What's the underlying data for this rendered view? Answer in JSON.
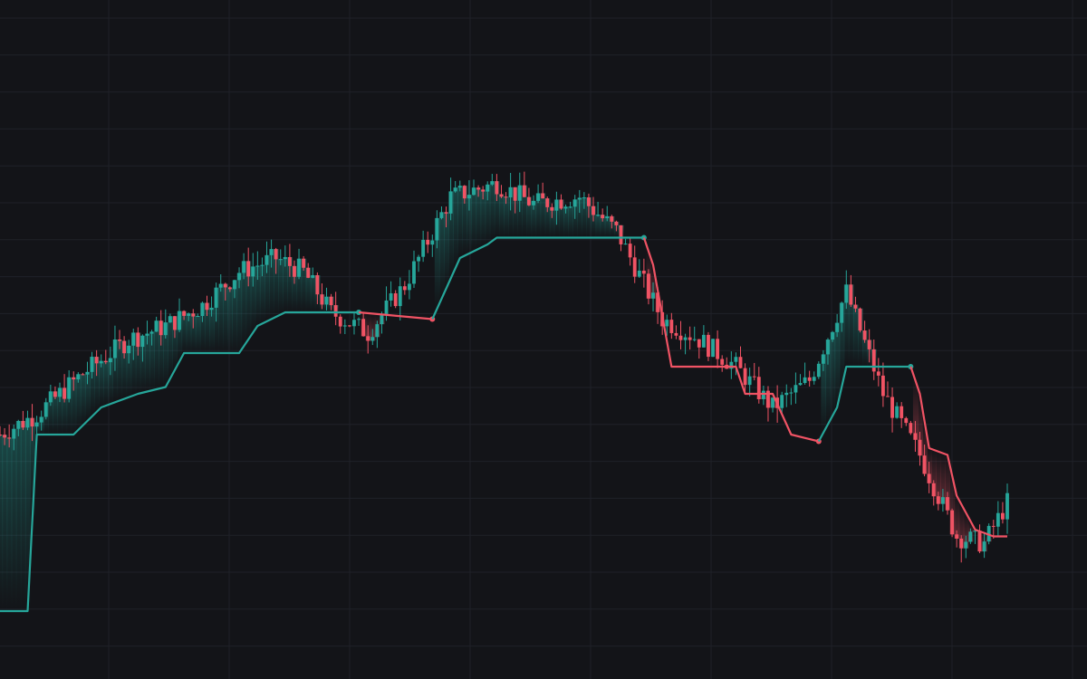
{
  "colors": {
    "background": "#131418",
    "grid": "#1f2128",
    "bull": "#26a69a",
    "bear": "#f05364"
  },
  "chart_data": {
    "type": "candlestick",
    "grid": true,
    "ylim": [
      0,
      100
    ],
    "series_count": 220,
    "price_keypoints": [
      {
        "t": 0,
        "v": 36
      },
      {
        "t": 8,
        "v": 39
      },
      {
        "t": 18,
        "v": 45
      },
      {
        "t": 28,
        "v": 50
      },
      {
        "t": 36,
        "v": 52
      },
      {
        "t": 44,
        "v": 55
      },
      {
        "t": 52,
        "v": 60
      },
      {
        "t": 60,
        "v": 62
      },
      {
        "t": 66,
        "v": 60
      },
      {
        "t": 72,
        "v": 54
      },
      {
        "t": 80,
        "v": 51
      },
      {
        "t": 88,
        "v": 58
      },
      {
        "t": 98,
        "v": 71
      },
      {
        "t": 108,
        "v": 73
      },
      {
        "t": 116,
        "v": 70
      },
      {
        "t": 126,
        "v": 71
      },
      {
        "t": 134,
        "v": 66
      },
      {
        "t": 144,
        "v": 53
      },
      {
        "t": 152,
        "v": 50
      },
      {
        "t": 160,
        "v": 46
      },
      {
        "t": 168,
        "v": 40
      },
      {
        "t": 176,
        "v": 44
      },
      {
        "t": 184,
        "v": 57
      },
      {
        "t": 192,
        "v": 42
      },
      {
        "t": 200,
        "v": 33
      },
      {
        "t": 208,
        "v": 21
      },
      {
        "t": 214,
        "v": 20
      },
      {
        "t": 219,
        "v": 26
      }
    ],
    "trailing_stop_segments": [
      {
        "trend": "bull",
        "points": [
          {
            "t": -10,
            "v": 10
          },
          {
            "t": 6,
            "v": 10
          },
          {
            "t": 8,
            "v": 36
          },
          {
            "t": 16,
            "v": 36
          },
          {
            "t": 22,
            "v": 40
          },
          {
            "t": 30,
            "v": 42
          },
          {
            "t": 36,
            "v": 43
          },
          {
            "t": 40,
            "v": 48
          },
          {
            "t": 52,
            "v": 48
          },
          {
            "t": 56,
            "v": 52
          },
          {
            "t": 62,
            "v": 54
          },
          {
            "t": 78,
            "v": 54
          }
        ],
        "end_marker": true
      },
      {
        "trend": "bear",
        "points": [
          {
            "t": 78,
            "v": 54
          },
          {
            "t": 94,
            "v": 53
          }
        ],
        "end_marker": true
      },
      {
        "trend": "bull",
        "points": [
          {
            "t": 94,
            "v": 53
          },
          {
            "t": 100,
            "v": 62
          },
          {
            "t": 106,
            "v": 64
          },
          {
            "t": 108,
            "v": 65
          },
          {
            "t": 140,
            "v": 65
          }
        ],
        "end_marker": true
      },
      {
        "trend": "bear",
        "points": [
          {
            "t": 140,
            "v": 65
          },
          {
            "t": 142,
            "v": 61
          },
          {
            "t": 146,
            "v": 46
          },
          {
            "t": 150,
            "v": 46
          },
          {
            "t": 160,
            "v": 46
          },
          {
            "t": 162,
            "v": 42
          },
          {
            "t": 168,
            "v": 42
          },
          {
            "t": 172,
            "v": 36
          },
          {
            "t": 178,
            "v": 35
          }
        ],
        "end_marker": true
      },
      {
        "trend": "bull",
        "points": [
          {
            "t": 178,
            "v": 35
          },
          {
            "t": 182,
            "v": 40
          },
          {
            "t": 184,
            "v": 46
          },
          {
            "t": 198,
            "v": 46
          }
        ],
        "end_marker": true
      },
      {
        "trend": "bear",
        "points": [
          {
            "t": 198,
            "v": 46
          },
          {
            "t": 200,
            "v": 42
          },
          {
            "t": 202,
            "v": 34
          },
          {
            "t": 206,
            "v": 33
          },
          {
            "t": 208,
            "v": 27
          },
          {
            "t": 212,
            "v": 22
          },
          {
            "t": 216,
            "v": 21
          },
          {
            "t": 219,
            "v": 21
          }
        ],
        "end_marker": false
      }
    ]
  }
}
